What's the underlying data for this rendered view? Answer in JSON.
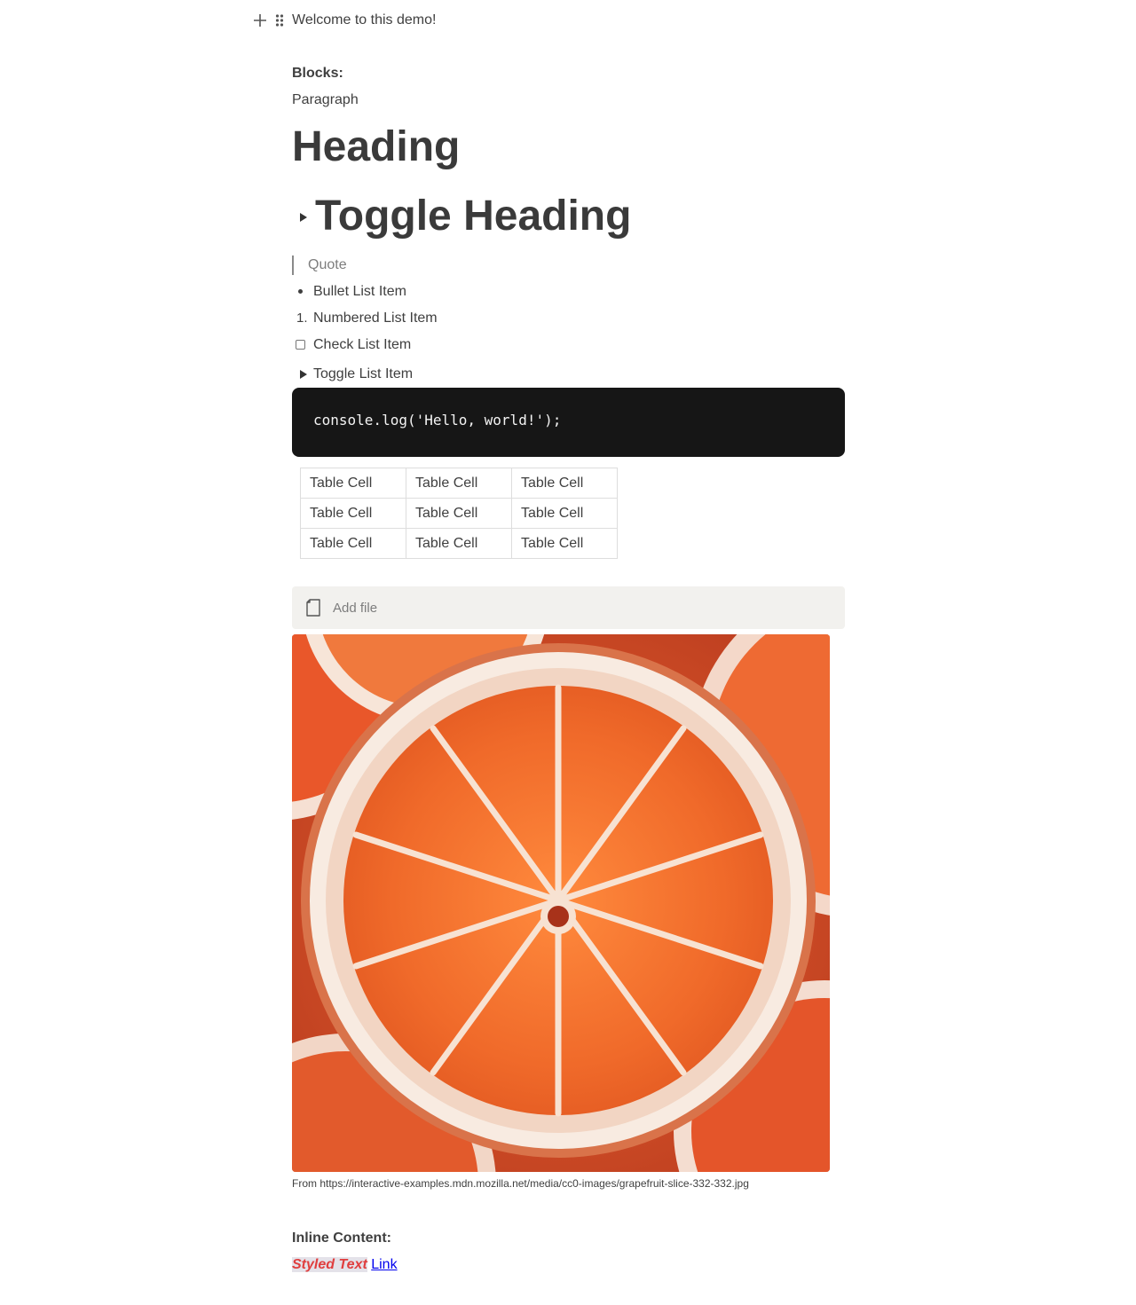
{
  "editor": {
    "first_block": "Welcome to this demo!",
    "blocks_label": "Blocks:",
    "paragraph": "Paragraph",
    "heading": "Heading",
    "toggle_heading": "Toggle Heading",
    "quote": "Quote",
    "bullet_item": "Bullet List Item",
    "numbered_marker": "1.",
    "numbered_item": "Numbered List Item",
    "check_item": "Check List Item",
    "check_item_checked": false,
    "toggle_item": "Toggle List Item",
    "code": "console.log('Hello, world!');",
    "table": {
      "rows": [
        [
          "Table Cell",
          "Table Cell",
          "Table Cell"
        ],
        [
          "Table Cell",
          "Table Cell",
          "Table Cell"
        ],
        [
          "Table Cell",
          "Table Cell",
          "Table Cell"
        ]
      ]
    },
    "file_block": {
      "label": "Add file",
      "icon": "file-icon"
    },
    "image": {
      "alt": "grapefruit slice",
      "caption": "From https://interactive-examples.mdn.mozilla.net/media/cc0-images/grapefruit-slice-332-332.jpg"
    },
    "inline_label": "Inline Content:",
    "styled_text": "Styled Text",
    "link_text": "Link"
  },
  "colors": {
    "text": "#3f3f3f",
    "code_bg": "#161616",
    "file_bg": "#f2f1ee",
    "styled_text_color": "#e03e3e",
    "styled_text_bg": "#e4e2e9",
    "link": "#0000ee"
  },
  "icons": [
    "plus-icon",
    "drag-handle-icon",
    "toggle-arrow-icon",
    "file-icon"
  ]
}
